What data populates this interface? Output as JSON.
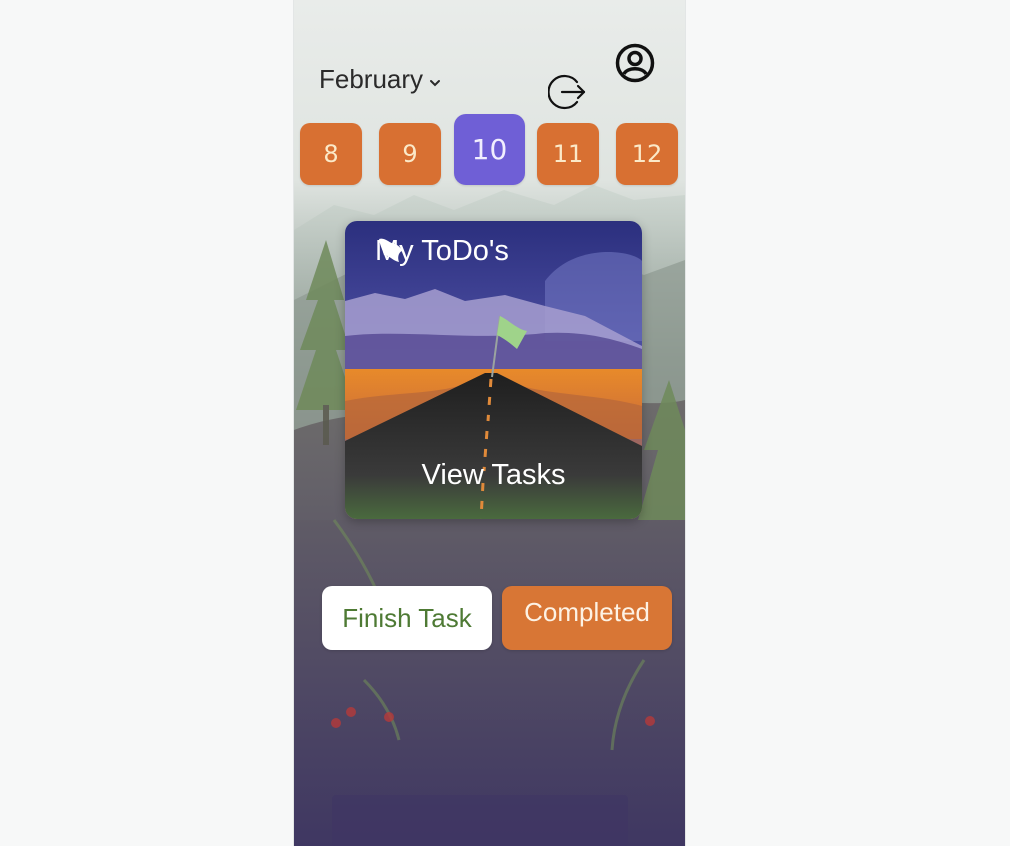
{
  "header": {
    "month": "February",
    "month_icon": "chevron-down-icon",
    "profile_icon": "user-circle-icon",
    "logout_icon": "logout-icon"
  },
  "days": [
    {
      "label": "8",
      "selected": false
    },
    {
      "label": "9",
      "selected": false
    },
    {
      "label": "10",
      "selected": true
    },
    {
      "label": "11",
      "selected": false
    },
    {
      "label": "12",
      "selected": false
    }
  ],
  "card": {
    "title": "My ToDo's",
    "title_icon": "flag-icon",
    "action": "View Tasks"
  },
  "actions": {
    "finish_label": "Finish Task",
    "completed_label": "Completed"
  },
  "colors": {
    "day_default": "#d87032",
    "day_selected": "#6f5fd6",
    "finish_text": "#4e7a34",
    "completed_bg": "#d87635"
  }
}
